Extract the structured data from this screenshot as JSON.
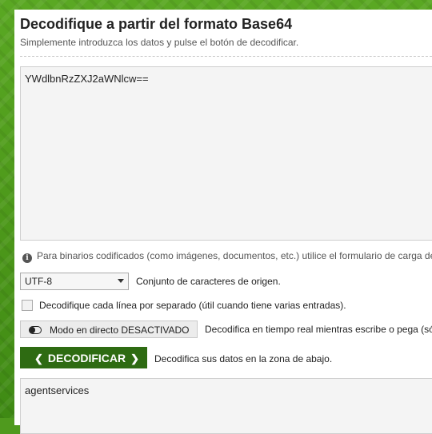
{
  "header": {
    "title": "Decodifique a partir del formato Base64",
    "subtitle": "Simplemente introduzca los datos y pulse el botón de decodificar."
  },
  "input": {
    "value": "YWdlbnRzZXJ2aWNlcw=="
  },
  "info": {
    "text": "Para binarios codificados (como imágenes, documentos, etc.) utilice el formulario de carga de"
  },
  "options": {
    "charset_selected": "UTF-8",
    "charset_label": "Conjunto de caracteres de origen.",
    "per_line_label": "Decodifique cada línea por separado (útil cuando tiene varias entradas).",
    "per_line_checked": false,
    "live_mode_label": "Modo en directo DESACTIVADO",
    "live_mode_desc": "Decodifica en tiempo real mientras escribe o pega (só"
  },
  "decode": {
    "button_label": "DECODIFICAR",
    "desc": "Decodifica sus datos en la zona de abajo."
  },
  "output": {
    "value": "agentservices"
  }
}
